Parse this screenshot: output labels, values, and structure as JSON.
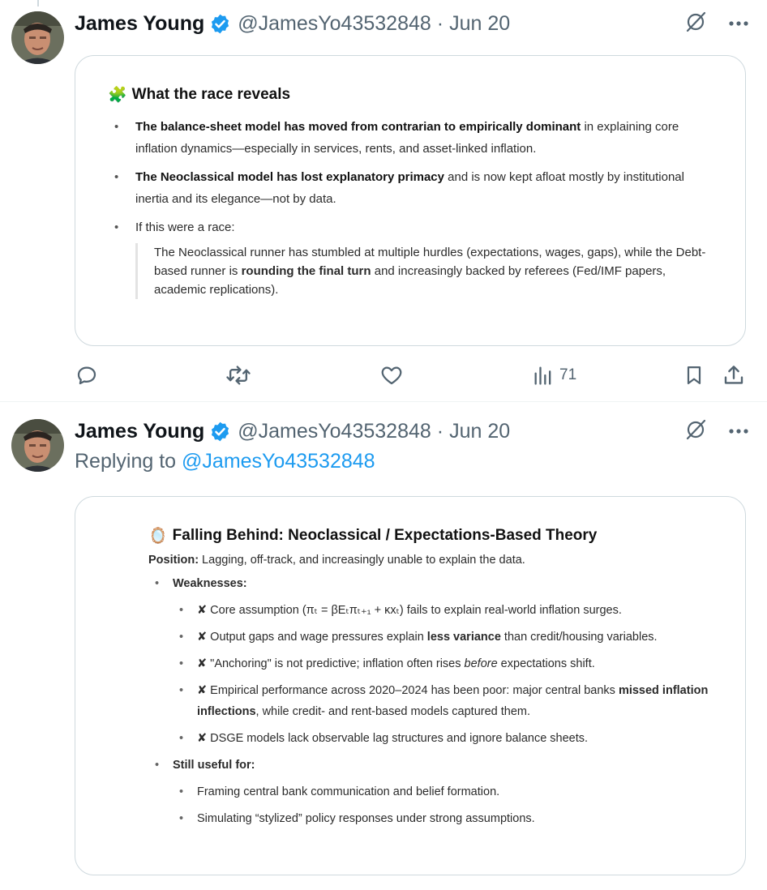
{
  "colors": {
    "accent": "#1d9bf0",
    "text": "#0f1419",
    "muted": "#536471",
    "border": "#cfd9de"
  },
  "tweet1": {
    "author": {
      "name": "James Young",
      "handle": "@JamesYo43532848",
      "separator": "·",
      "date": "Jun 20",
      "avatar": "avatar-photo"
    },
    "card": {
      "heading_emoji": "🧩",
      "heading": "What the race reveals",
      "bullets": [
        {
          "bold": "The balance-sheet model has moved from contrarian to empirically dominant",
          "rest": " in explaining core inflation dynamics—especially in services, rents, and asset-linked inflation."
        },
        {
          "bold": "The Neoclassical model has lost explanatory primacy",
          "rest": " and is now kept afloat mostly by institutional inertia and its elegance—not by data."
        },
        {
          "bold": "",
          "rest": "If this were a race:"
        }
      ],
      "quote_pre": "The Neoclassical runner has stumbled at multiple hurdles (expectations, wages, gaps), while the Debt-based runner is ",
      "quote_bold": "rounding the final turn",
      "quote_post": " and increasingly backed by referees (Fed/IMF papers, academic replications)."
    },
    "actions": {
      "views": "71"
    }
  },
  "tweet2": {
    "author": {
      "name": "James Young",
      "handle": "@JamesYo43532848",
      "separator": "·",
      "date": "Jun 20",
      "avatar": "avatar-photo"
    },
    "reply_prefix": "Replying to ",
    "reply_handle": "@JamesYo43532848",
    "card": {
      "heading_emoji": "🪞",
      "heading": "Falling Behind: Neoclassical / Expectations-Based Theory",
      "position_label": "Position:",
      "position_text": " Lagging, off-track, and increasingly unable to explain the data.",
      "weak_label": "Weaknesses:",
      "weak_items": [
        {
          "pre": "✘ Core assumption (πₜ = βEₜπₜ₊₁ + κxₜ) fails to explain real-world inflation surges.",
          "bold": "",
          "post": ""
        },
        {
          "pre": "✘ Output gaps and wage pressures explain ",
          "bold": "less variance",
          "post": " than credit/housing variables."
        },
        {
          "pre": "✘ \"Anchoring\" is not predictive; inflation often rises ",
          "italic": "before",
          "post": " expectations shift."
        },
        {
          "pre": "✘ Empirical performance across 2020–2024 has been poor: major central banks ",
          "bold": "missed inflation inflections",
          "post": ", while credit- and rent-based models captured them."
        },
        {
          "pre": "✘ DSGE models lack observable lag structures and ignore balance sheets.",
          "bold": "",
          "post": ""
        }
      ],
      "useful_label": "Still useful for:",
      "useful_items": [
        "Framing central bank communication and belief formation.",
        "Simulating “stylized” policy responses under strong assumptions."
      ]
    }
  }
}
